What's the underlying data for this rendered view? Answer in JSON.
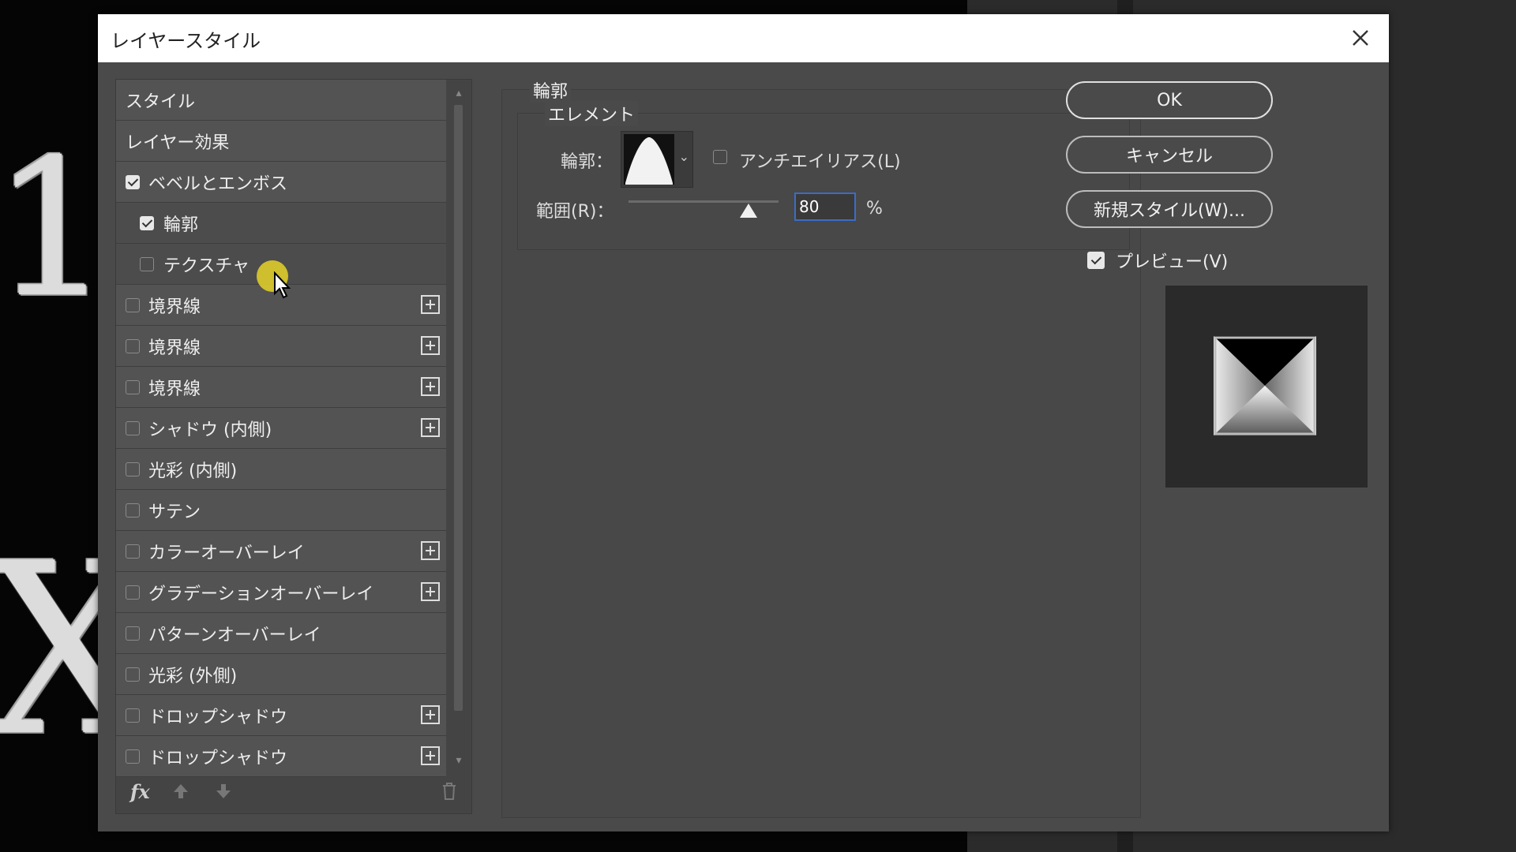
{
  "dialog": {
    "title": "レイヤースタイル"
  },
  "style_list": {
    "items": [
      {
        "label": "スタイル",
        "checkbox": false,
        "checked": false,
        "plus": false
      },
      {
        "label": "レイヤー効果",
        "checkbox": false,
        "checked": false,
        "plus": false
      },
      {
        "label": "ベベルとエンボス",
        "checkbox": true,
        "checked": true,
        "plus": false
      },
      {
        "label": "輪郭",
        "checkbox": true,
        "checked": true,
        "plus": false,
        "selected": true,
        "indent": true
      },
      {
        "label": "テクスチャ",
        "checkbox": true,
        "checked": false,
        "plus": false,
        "indent": true
      },
      {
        "label": "境界線",
        "checkbox": true,
        "checked": false,
        "plus": true
      },
      {
        "label": "境界線",
        "checkbox": true,
        "checked": false,
        "plus": true
      },
      {
        "label": "境界線",
        "checkbox": true,
        "checked": false,
        "plus": true
      },
      {
        "label": "シャドウ (内側)",
        "checkbox": true,
        "checked": false,
        "plus": true
      },
      {
        "label": "光彩 (内側)",
        "checkbox": true,
        "checked": false,
        "plus": false
      },
      {
        "label": "サテン",
        "checkbox": true,
        "checked": false,
        "plus": false
      },
      {
        "label": "カラーオーバーレイ",
        "checkbox": true,
        "checked": false,
        "plus": true
      },
      {
        "label": "グラデーションオーバーレイ",
        "checkbox": true,
        "checked": false,
        "plus": true
      },
      {
        "label": "パターンオーバーレイ",
        "checkbox": true,
        "checked": false,
        "plus": false
      },
      {
        "label": "光彩 (外側)",
        "checkbox": true,
        "checked": false,
        "plus": false
      },
      {
        "label": "ドロップシャドウ",
        "checkbox": true,
        "checked": false,
        "plus": true
      },
      {
        "label": "ドロップシャドウ",
        "checkbox": true,
        "checked": false,
        "plus": true
      }
    ],
    "footer": {
      "fx_label": "fx"
    }
  },
  "panel": {
    "legend": "輪郭",
    "group_legend": "エレメント",
    "contour_label": "輪郭：",
    "antialias_label": "アンチエイリアス(L)",
    "antialias_checked": false,
    "range_label": "範囲(R)：",
    "range_value": "80",
    "range_unit": "%",
    "range_fraction": 0.8
  },
  "buttons": {
    "ok": "OK",
    "cancel": "キャンセル",
    "new_style": "新規スタイル(W)...",
    "preview_label": "プレビュー(V)",
    "preview_checked": true
  },
  "icons": {
    "close": "close-icon",
    "fx": "fx-icon",
    "move_up": "arrow-up-icon",
    "move_down": "arrow-down-icon",
    "delete": "trash-icon",
    "add": "plus-icon"
  }
}
